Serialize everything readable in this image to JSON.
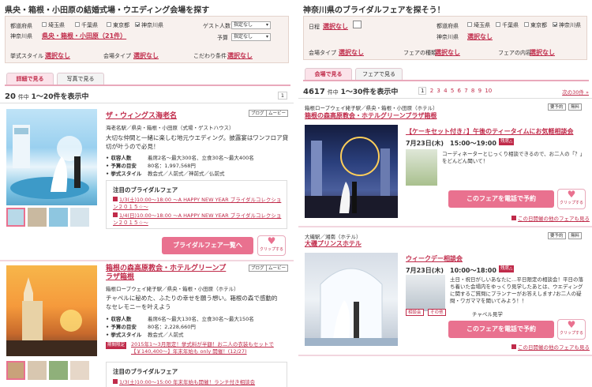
{
  "left": {
    "title": "県央・箱根・小田原の結婚式場・ウエディング会場を探す",
    "search": {
      "pref_label": "都道府県",
      "prefs": [
        {
          "name": "埼玉県",
          "checked": false
        },
        {
          "name": "千葉県",
          "checked": false
        },
        {
          "name": "東京都",
          "checked": false
        },
        {
          "name": "神奈川県",
          "checked": true
        }
      ],
      "area_label": "神奈川県",
      "area_value": "県央・箱根・小田原（21件）",
      "guest_label": "ゲスト人数",
      "guest_value": "指定なし",
      "budget_label": "予算",
      "budget_value": "指定なし",
      "style_label": "挙式スタイル",
      "style_value": "選択なし",
      "type_label": "会場タイプ",
      "type_value": "選択なし",
      "kodawari_label": "こだわり条件",
      "kodawari_value": "選択なし"
    },
    "tabs": [
      "詳細で見る",
      "写真で見る"
    ],
    "count": "20",
    "count_unit": "件中",
    "range": "1〜20件を表示中",
    "page": "1",
    "v1": {
      "name": "ザ・ウィングス海老名",
      "tags": [
        "ブログ",
        "ムービー"
      ],
      "loc": "海老名駅／県央・箱根・小田原（式場・ゲストハウス）",
      "catch": "大切な仲間と一緒に楽しむ地元ウエディング。披露宴はワンフロア貸切が叶うので必見！",
      "rows": [
        {
          "k": "• 収容人数",
          "v": "着席2名〜最大300名、立食30名〜最大400名"
        },
        {
          "k": "• 予算の目安",
          "v": "80名：1,997,568円"
        },
        {
          "k": "• 挙式スタイル",
          "v": "教会式／人前式／神前式／仏前式"
        }
      ],
      "fair_head": "注目のブライダルフェア",
      "fairs": [
        "1/3(土)10:00〜18:00 〜A HAPPY NEW YEAR ブライダルコレクション２０１５☆〜",
        "1/4(日)10:00〜18:00 〜A HAPPY NEW YEAR ブライダルコレクション２０１５☆〜"
      ],
      "btn": "ブライダルフェア一覧へ",
      "clip": "クリップする"
    },
    "v2": {
      "name": "箱根の森高原教会・ホテルグリーンプラザ箱根",
      "tags": [
        "ブログ",
        "ムービー"
      ],
      "loc": "箱根ロープウェイ姥子駅／県央・箱根・小田原（ホテル）",
      "catch": "チャペルに秘めた、ふたりの幸せを願う想い。箱根の森で感動的なセレモニーを叶えよう",
      "rows": [
        {
          "k": "• 収容人数",
          "v": "着席6名〜最大130名、立食30名〜最大150名"
        },
        {
          "k": "• 予算の目安",
          "v": "80名：2,228,660円"
        },
        {
          "k": "• 挙式スタイル",
          "v": "教会式／人前式"
        }
      ],
      "special_tag": "期間限定",
      "special": "2015年1〜3月限定！挙式料が半額！お二人の衣装もセットで【￥140,400〜】年末年始も only 開催！(12/27)",
      "fair_head": "注目のブライダルフェア",
      "fairs": [
        "1/3(土)10:00〜15:00 年末年始も開催！ランチ付き相談会"
      ]
    }
  },
  "right": {
    "title": "神奈川県のブライダルフェアを探そう！",
    "search": {
      "date_label": "日程",
      "date_value": "選択なし",
      "pref_label": "都道府県",
      "prefs": [
        {
          "name": "埼玉県",
          "checked": false
        },
        {
          "name": "千葉県",
          "checked": false
        },
        {
          "name": "東京都",
          "checked": false
        },
        {
          "name": "神奈川県",
          "checked": true
        }
      ],
      "area_label": "神奈川県",
      "area_value": "選択なし",
      "type_label": "会場タイプ",
      "type_value": "選択なし",
      "fair_type_label": "フェアの種類",
      "fair_type_value": "選択なし",
      "fair_content_label": "フェアの内容",
      "fair_content_value": "選択なし"
    },
    "tabs": [
      "会場で見る",
      "フェアで見る"
    ],
    "count": "4617",
    "count_unit": "件中",
    "range": "1〜30件を表示中",
    "pages": [
      "1",
      "2",
      "3",
      "4",
      "5",
      "6",
      "7",
      "8",
      "9",
      "10"
    ],
    "next": "次の30件 »",
    "v1": {
      "loc": "箱根ロープウェイ姥子駅／県央・箱根・小田原（ホテル）",
      "name": "箱根の森高原教会・ホテルグリーンプラザ箱根",
      "tags": [
        "要予約",
        "無料"
      ],
      "fair_title": "【ケーキセット付き♪】午後のティータイムにお気軽相談会",
      "fair_time": "7月23日(木)　15:00〜19:00",
      "badge": "残席△",
      "desc": "コーディネーターとじっくり相談できるので、お二人の「？」をどんどん聞いて！",
      "btn": "このフェアを電話で予約",
      "clip": "クリップする",
      "more": "この日開催の他のフェアも見る"
    },
    "v2": {
      "loc": "大磯駅／湘南（ホテル）",
      "name": "大磯プリンスホテル",
      "tags": [
        "要予約",
        "無料"
      ],
      "fair_title": "ウィークデー相談会",
      "fair_time": "7月23日(木)　10:00〜18:00",
      "badge": "残席△",
      "desc": "土日・祝日がしいあなたに…平日限定の相談会！平日の落ち着いた会場内をゆっくり見学したあとは、ウエディングに関するご質問にプランナーがお答えします♪お二人の疑問・ワガママを聞いてみよう！！",
      "mini_tags": [
        "相談会",
        "その他"
      ],
      "sub": "チャペル見学",
      "btn": "このフェアを電話で予約",
      "clip": "クリップする",
      "more": "この日開催の他のフェアも見る"
    }
  }
}
